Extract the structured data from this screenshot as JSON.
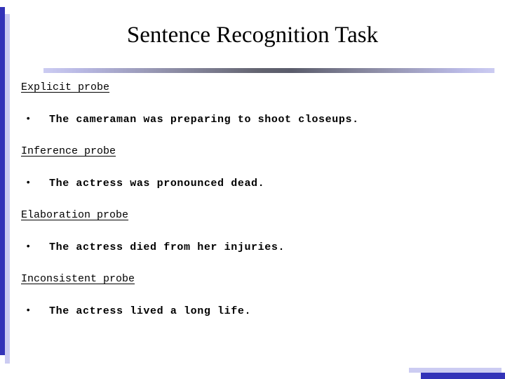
{
  "slide": {
    "title": "Sentence Recognition Task",
    "bullet_glyph": "•",
    "colors": {
      "accent_dark_blue": "#3333b8",
      "accent_light_lavender": "#ccccf2",
      "rule_center_gray": "#5a5c6b",
      "text": "#000000",
      "background": "#ffffff"
    },
    "sections": [
      {
        "heading": "Explicit probe",
        "bullet": "The cameraman was preparing to shoot closeups."
      },
      {
        "heading": "Inference probe",
        "bullet": "The actress was pronounced dead."
      },
      {
        "heading": "Elaboration probe",
        "bullet": "The actress died from her injuries."
      },
      {
        "heading": "Inconsistent probe",
        "bullet": "The actress lived a long life."
      }
    ]
  }
}
